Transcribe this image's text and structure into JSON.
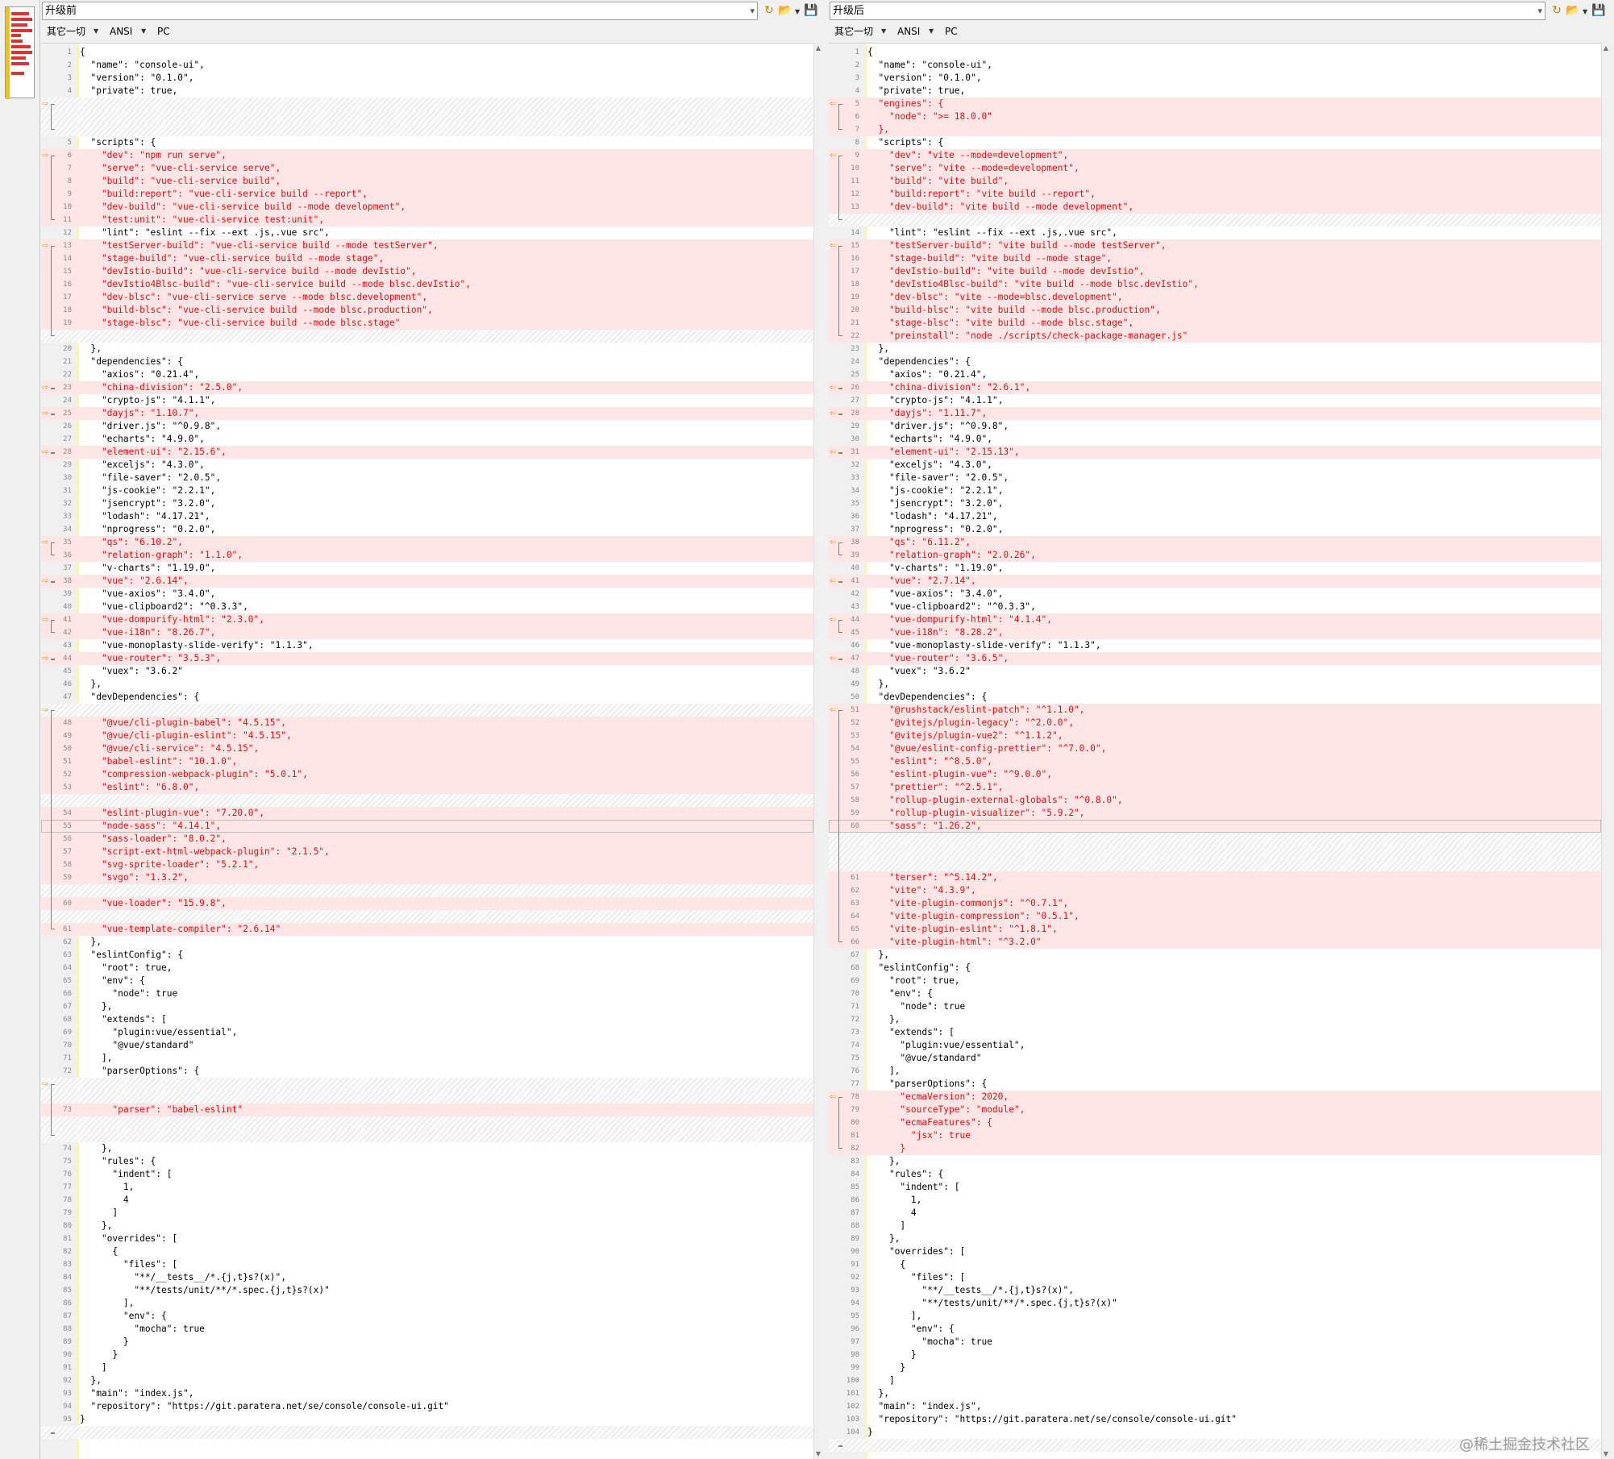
{
  "app": {
    "watermark": "@稀土掘金技术社区"
  },
  "colors": {
    "diff_bg": "#ffe5e5",
    "diff_text": "#dd1111",
    "arrow": "#d99a00"
  },
  "left": {
    "path": "升级前",
    "info": {
      "whitespace": "其它一切",
      "encoding": "ANSI",
      "line_ending": "PC"
    },
    "lines": [
      {
        "n": 1,
        "t": "{"
      },
      {
        "n": 2,
        "t": "  \"name\": \"console-ui\","
      },
      {
        "n": 3,
        "t": "  \"version\": \"0.1.0\","
      },
      {
        "n": 4,
        "t": "  \"private\": true,"
      },
      {
        "gap": true,
        "arrow": true
      },
      {
        "gap": true
      },
      {
        "gap": true
      },
      {
        "n": 5,
        "t": "  \"scripts\": {"
      },
      {
        "n": 6,
        "t": "    \"dev\": \"npm run serve\",",
        "d": true,
        "arrow": true
      },
      {
        "n": 7,
        "t": "    \"serve\": \"vue-cli-service serve\",",
        "d": true
      },
      {
        "n": 8,
        "t": "    \"build\": \"vue-cli-service build\",",
        "d": true
      },
      {
        "n": 9,
        "t": "    \"build:report\": \"vue-cli-service build --report\",",
        "d": true
      },
      {
        "n": 10,
        "t": "    \"dev-build\": \"vue-cli-service build --mode development\",",
        "d": true
      },
      {
        "n": 11,
        "t": "    \"test:unit\": \"vue-cli-service test:unit\",",
        "d": true
      },
      {
        "n": 12,
        "t": "    \"lint\": \"eslint --fix --ext .js,.vue src\","
      },
      {
        "n": 13,
        "t": "    \"testServer-build\": \"vue-cli-service build --mode testServer\",",
        "d": true,
        "arrow": true
      },
      {
        "n": 14,
        "t": "    \"stage-build\": \"vue-cli-service build --mode stage\",",
        "d": true
      },
      {
        "n": 15,
        "t": "    \"devIstio-build\": \"vue-cli-service build --mode devIstio\",",
        "d": true
      },
      {
        "n": 16,
        "t": "    \"devIstio4Blsc-build\": \"vue-cli-service build --mode blsc.devIstio\",",
        "d": true
      },
      {
        "n": 17,
        "t": "    \"dev-blsc\": \"vue-cli-service serve --mode blsc.development\",",
        "d": true
      },
      {
        "n": 18,
        "t": "    \"build-blsc\": \"vue-cli-service build --mode blsc.production\",",
        "d": true
      },
      {
        "n": 19,
        "t": "    \"stage-blsc\": \"vue-cli-service build --mode blsc.stage\"",
        "d": true
      },
      {
        "gap": true
      },
      {
        "n": 20,
        "t": "  },"
      },
      {
        "n": 21,
        "t": "  \"dependencies\": {"
      },
      {
        "n": 22,
        "t": "    \"axios\": \"0.21.4\","
      },
      {
        "n": 23,
        "t": "    \"china-division\": \"2.5.0\",",
        "d": true,
        "arrow": true
      },
      {
        "n": 24,
        "t": "    \"crypto-js\": \"4.1.1\","
      },
      {
        "n": 25,
        "t": "    \"dayjs\": \"1.10.7\",",
        "d": true,
        "arrow": true
      },
      {
        "n": 26,
        "t": "    \"driver.js\": \"^0.9.8\","
      },
      {
        "n": 27,
        "t": "    \"echarts\": \"4.9.0\","
      },
      {
        "n": 28,
        "t": "    \"element-ui\": \"2.15.6\",",
        "d": true,
        "arrow": true
      },
      {
        "n": 29,
        "t": "    \"exceljs\": \"4.3.0\","
      },
      {
        "n": 30,
        "t": "    \"file-saver\": \"2.0.5\","
      },
      {
        "n": 31,
        "t": "    \"js-cookie\": \"2.2.1\","
      },
      {
        "n": 32,
        "t": "    \"jsencrypt\": \"3.2.0\","
      },
      {
        "n": 33,
        "t": "    \"lodash\": \"4.17.21\","
      },
      {
        "n": 34,
        "t": "    \"nprogress\": \"0.2.0\","
      },
      {
        "n": 35,
        "t": "    \"qs\": \"6.10.2\",",
        "d": true,
        "arrow": true
      },
      {
        "n": 36,
        "t": "    \"relation-graph\": \"1.1.0\",",
        "d": true
      },
      {
        "n": 37,
        "t": "    \"v-charts\": \"1.19.0\","
      },
      {
        "n": 38,
        "t": "    \"vue\": \"2.6.14\",",
        "d": true,
        "arrow": true
      },
      {
        "n": 39,
        "t": "    \"vue-axios\": \"3.4.0\","
      },
      {
        "n": 40,
        "t": "    \"vue-clipboard2\": \"^0.3.3\","
      },
      {
        "n": 41,
        "t": "    \"vue-dompurify-html\": \"2.3.0\",",
        "d": true,
        "arrow": true
      },
      {
        "n": 42,
        "t": "    \"vue-i18n\": \"8.26.7\",",
        "d": true
      },
      {
        "n": 43,
        "t": "    \"vue-monoplasty-slide-verify\": \"1.1.3\","
      },
      {
        "n": 44,
        "t": "    \"vue-router\": \"3.5.3\",",
        "d": true,
        "arrow": true
      },
      {
        "n": 45,
        "t": "    \"vuex\": \"3.6.2\""
      },
      {
        "n": 46,
        "t": "  },"
      },
      {
        "n": 47,
        "t": "  \"devDependencies\": {"
      },
      {
        "gap": true,
        "arrow": true
      },
      {
        "n": 48,
        "t": "    \"@vue/cli-plugin-babel\": \"4.5.15\",",
        "d": true
      },
      {
        "n": 49,
        "t": "    \"@vue/cli-plugin-eslint\": \"4.5.15\",",
        "d": true
      },
      {
        "n": 50,
        "t": "    \"@vue/cli-service\": \"4.5.15\",",
        "d": true
      },
      {
        "n": 51,
        "t": "    \"babel-eslint\": \"10.1.0\",",
        "d": true
      },
      {
        "n": 52,
        "t": "    \"compression-webpack-plugin\": \"5.0.1\",",
        "d": true
      },
      {
        "n": 53,
        "t": "    \"eslint\": \"6.8.0\",",
        "d": true
      },
      {
        "gap": true
      },
      {
        "n": 54,
        "t": "    \"eslint-plugin-vue\": \"7.20.0\",",
        "d": true
      },
      {
        "n": 55,
        "t": "    \"node-sass\": \"4.14.1\",",
        "d": true,
        "cursor": true
      },
      {
        "n": 56,
        "t": "    \"sass-loader\": \"8.0.2\",",
        "d": true
      },
      {
        "n": 57,
        "t": "    \"script-ext-html-webpack-plugin\": \"2.1.5\",",
        "d": true
      },
      {
        "n": 58,
        "t": "    \"svg-sprite-loader\": \"5.2.1\",",
        "d": true
      },
      {
        "n": 59,
        "t": "    \"svgo\": \"1.3.2\",",
        "d": true
      },
      {
        "gap": true
      },
      {
        "n": 60,
        "t": "    \"vue-loader\": \"15.9.8\",",
        "d": true
      },
      {
        "gap": true
      },
      {
        "n": 61,
        "t": "    \"vue-template-compiler\": \"2.6.14\"",
        "d": true
      },
      {
        "n": 62,
        "t": "  },"
      },
      {
        "n": 63,
        "t": "  \"eslintConfig\": {"
      },
      {
        "n": 64,
        "t": "    \"root\": true,"
      },
      {
        "n": 65,
        "t": "    \"env\": {"
      },
      {
        "n": 66,
        "t": "      \"node\": true"
      },
      {
        "n": 67,
        "t": "    },"
      },
      {
        "n": 68,
        "t": "    \"extends\": ["
      },
      {
        "n": 69,
        "t": "      \"plugin:vue/essential\","
      },
      {
        "n": 70,
        "t": "      \"@vue/standard\""
      },
      {
        "n": 71,
        "t": "    ],"
      },
      {
        "n": 72,
        "t": "    \"parserOptions\": {"
      },
      {
        "gap": true,
        "arrow": true
      },
      {
        "gap": true
      },
      {
        "n": 73,
        "t": "      \"parser\": \"babel-eslint\"",
        "d": true
      },
      {
        "gap": true
      },
      {
        "gap": true
      },
      {
        "n": 74,
        "t": "    },"
      },
      {
        "n": 75,
        "t": "    \"rules\": {"
      },
      {
        "n": 76,
        "t": "      \"indent\": ["
      },
      {
        "n": 77,
        "t": "        1,"
      },
      {
        "n": 78,
        "t": "        4"
      },
      {
        "n": 79,
        "t": "      ]"
      },
      {
        "n": 80,
        "t": "    },"
      },
      {
        "n": 81,
        "t": "    \"overrides\": ["
      },
      {
        "n": 82,
        "t": "      {"
      },
      {
        "n": 83,
        "t": "        \"files\": ["
      },
      {
        "n": 84,
        "t": "          \"**/__tests__/*.{j,t}s?(x)\","
      },
      {
        "n": 85,
        "t": "          \"**/tests/unit/**/*.spec.{j,t}s?(x)\""
      },
      {
        "n": 86,
        "t": "        ],"
      },
      {
        "n": 87,
        "t": "        \"env\": {"
      },
      {
        "n": 88,
        "t": "          \"mocha\": true"
      },
      {
        "n": 89,
        "t": "        }"
      },
      {
        "n": 90,
        "t": "      }"
      },
      {
        "n": 91,
        "t": "    ]"
      },
      {
        "n": 92,
        "t": "  },"
      },
      {
        "n": 93,
        "t": "  \"main\": \"index.js\","
      },
      {
        "n": 94,
        "t": "  \"repository\": \"https://git.paratera.net/se/console/console-ui.git\""
      },
      {
        "n": 95,
        "t": "}"
      },
      {
        "gap": true
      }
    ]
  },
  "right": {
    "path": "升级后",
    "info": {
      "whitespace": "其它一切",
      "encoding": "ANSI",
      "line_ending": "PC"
    },
    "lines": [
      {
        "n": 1,
        "t": "{"
      },
      {
        "n": 2,
        "t": "  \"name\": \"console-ui\","
      },
      {
        "n": 3,
        "t": "  \"version\": \"0.1.0\","
      },
      {
        "n": 4,
        "t": "  \"private\": true,"
      },
      {
        "n": 5,
        "t": "  \"engines\": {",
        "d": true,
        "arrow": true
      },
      {
        "n": 6,
        "t": "    \"node\": \">= 18.0.0\"",
        "d": true
      },
      {
        "n": 7,
        "t": "  },",
        "d": true
      },
      {
        "n": 8,
        "t": "  \"scripts\": {"
      },
      {
        "n": 9,
        "t": "    \"dev\": \"vite --mode=development\",",
        "d": true,
        "arrow": true
      },
      {
        "n": 10,
        "t": "    \"serve\": \"vite --mode=development\",",
        "d": true
      },
      {
        "n": 11,
        "t": "    \"build\": \"vite build\",",
        "d": true
      },
      {
        "n": 12,
        "t": "    \"build:report\": \"vite build --report\",",
        "d": true
      },
      {
        "n": 13,
        "t": "    \"dev-build\": \"vite build --mode development\",",
        "d": true
      },
      {
        "gap": true
      },
      {
        "n": 14,
        "t": "    \"lint\": \"eslint --fix --ext .js,.vue src\","
      },
      {
        "n": 15,
        "t": "    \"testServer-build\": \"vite build --mode testServer\",",
        "d": true,
        "arrow": true
      },
      {
        "n": 16,
        "t": "    \"stage-build\": \"vite build --mode stage\",",
        "d": true
      },
      {
        "n": 17,
        "t": "    \"devIstio-build\": \"vite build --mode devIstio\",",
        "d": true
      },
      {
        "n": 18,
        "t": "    \"devIstio4Blsc-build\": \"vite build --mode blsc.devIstio\",",
        "d": true
      },
      {
        "n": 19,
        "t": "    \"dev-blsc\": \"vite --mode=blsc.development\",",
        "d": true
      },
      {
        "n": 20,
        "t": "    \"build-blsc\": \"vite build --mode blsc.production\",",
        "d": true
      },
      {
        "n": 21,
        "t": "    \"stage-blsc\": \"vite build --mode blsc.stage\",",
        "d": true
      },
      {
        "n": 22,
        "t": "    \"preinstall\": \"node ./scripts/check-package-manager.js\"",
        "d": true
      },
      {
        "n": 23,
        "t": "  },"
      },
      {
        "n": 24,
        "t": "  \"dependencies\": {"
      },
      {
        "n": 25,
        "t": "    \"axios\": \"0.21.4\","
      },
      {
        "n": 26,
        "t": "    \"china-division\": \"2.6.1\",",
        "d": true,
        "arrow": true
      },
      {
        "n": 27,
        "t": "    \"crypto-js\": \"4.1.1\","
      },
      {
        "n": 28,
        "t": "    \"dayjs\": \"1.11.7\",",
        "d": true,
        "arrow": true
      },
      {
        "n": 29,
        "t": "    \"driver.js\": \"^0.9.8\","
      },
      {
        "n": 30,
        "t": "    \"echarts\": \"4.9.0\","
      },
      {
        "n": 31,
        "t": "    \"element-ui\": \"2.15.13\",",
        "d": true,
        "arrow": true
      },
      {
        "n": 32,
        "t": "    \"exceljs\": \"4.3.0\","
      },
      {
        "n": 33,
        "t": "    \"file-saver\": \"2.0.5\","
      },
      {
        "n": 34,
        "t": "    \"js-cookie\": \"2.2.1\","
      },
      {
        "n": 35,
        "t": "    \"jsencrypt\": \"3.2.0\","
      },
      {
        "n": 36,
        "t": "    \"lodash\": \"4.17.21\","
      },
      {
        "n": 37,
        "t": "    \"nprogress\": \"0.2.0\","
      },
      {
        "n": 38,
        "t": "    \"qs\": \"6.11.2\",",
        "d": true,
        "arrow": true
      },
      {
        "n": 39,
        "t": "    \"relation-graph\": \"2.0.26\",",
        "d": true
      },
      {
        "n": 40,
        "t": "    \"v-charts\": \"1.19.0\","
      },
      {
        "n": 41,
        "t": "    \"vue\": \"2.7.14\",",
        "d": true,
        "arrow": true
      },
      {
        "n": 42,
        "t": "    \"vue-axios\": \"3.4.0\","
      },
      {
        "n": 43,
        "t": "    \"vue-clipboard2\": \"^0.3.3\","
      },
      {
        "n": 44,
        "t": "    \"vue-dompurify-html\": \"4.1.4\",",
        "d": true,
        "arrow": true
      },
      {
        "n": 45,
        "t": "    \"vue-i18n\": \"8.28.2\",",
        "d": true
      },
      {
        "n": 46,
        "t": "    \"vue-monoplasty-slide-verify\": \"1.1.3\","
      },
      {
        "n": 47,
        "t": "    \"vue-router\": \"3.6.5\",",
        "d": true,
        "arrow": true
      },
      {
        "n": 48,
        "t": "    \"vuex\": \"3.6.2\""
      },
      {
        "n": 49,
        "t": "  },"
      },
      {
        "n": 50,
        "t": "  \"devDependencies\": {"
      },
      {
        "n": 51,
        "t": "    \"@rushstack/eslint-patch\": \"^1.1.0\",",
        "d": true,
        "arrow": true
      },
      {
        "n": 52,
        "t": "    \"@vitejs/plugin-legacy\": \"^2.0.0\",",
        "d": true
      },
      {
        "n": 53,
        "t": "    \"@vitejs/plugin-vue2\": \"^1.1.2\",",
        "d": true
      },
      {
        "n": 54,
        "t": "    \"@vue/eslint-config-prettier\": \"^7.0.0\",",
        "d": true
      },
      {
        "n": 55,
        "t": "    \"eslint\": \"^8.5.0\",",
        "d": true
      },
      {
        "n": 56,
        "t": "    \"eslint-plugin-vue\": \"^9.0.0\",",
        "d": true
      },
      {
        "n": 57,
        "t": "    \"prettier\": \"^2.5.1\",",
        "d": true
      },
      {
        "n": 58,
        "t": "    \"rollup-plugin-external-globals\": \"^0.8.0\",",
        "d": true
      },
      {
        "n": 59,
        "t": "    \"rollup-plugin-visualizer\": \"5.9.2\",",
        "d": true
      },
      {
        "n": 60,
        "t": "    \"sass\": \"1.26.2\",",
        "d": true,
        "cursor": true
      },
      {
        "gap": true
      },
      {
        "gap": true
      },
      {
        "gap": true
      },
      {
        "n": 61,
        "t": "    \"terser\": \"^5.14.2\",",
        "d": true
      },
      {
        "n": 62,
        "t": "    \"vite\": \"4.3.9\",",
        "d": true
      },
      {
        "n": 63,
        "t": "    \"vite-plugin-commonjs\": \"^0.7.1\",",
        "d": true
      },
      {
        "n": 64,
        "t": "    \"vite-plugin-compression\": \"0.5.1\",",
        "d": true
      },
      {
        "n": 65,
        "t": "    \"vite-plugin-eslint\": \"^1.8.1\",",
        "d": true
      },
      {
        "n": 66,
        "t": "    \"vite-plugin-html\": \"^3.2.0\"",
        "d": true
      },
      {
        "n": 67,
        "t": "  },"
      },
      {
        "n": 68,
        "t": "  \"eslintConfig\": {"
      },
      {
        "n": 69,
        "t": "    \"root\": true,"
      },
      {
        "n": 70,
        "t": "    \"env\": {"
      },
      {
        "n": 71,
        "t": "      \"node\": true"
      },
      {
        "n": 72,
        "t": "    },"
      },
      {
        "n": 73,
        "t": "    \"extends\": ["
      },
      {
        "n": 74,
        "t": "      \"plugin:vue/essential\","
      },
      {
        "n": 75,
        "t": "      \"@vue/standard\""
      },
      {
        "n": 76,
        "t": "    ],"
      },
      {
        "n": 77,
        "t": "    \"parserOptions\": {"
      },
      {
        "n": 78,
        "t": "      \"ecmaVersion\": 2020,",
        "d": true,
        "arrow": true
      },
      {
        "n": 79,
        "t": "      \"sourceType\": \"module\",",
        "d": true
      },
      {
        "n": 80,
        "t": "      \"ecmaFeatures\": {",
        "d": true
      },
      {
        "n": 81,
        "t": "        \"jsx\": true",
        "d": true
      },
      {
        "n": 82,
        "t": "      }",
        "d": true
      },
      {
        "n": 83,
        "t": "    },"
      },
      {
        "n": 84,
        "t": "    \"rules\": {"
      },
      {
        "n": 85,
        "t": "      \"indent\": ["
      },
      {
        "n": 86,
        "t": "        1,"
      },
      {
        "n": 87,
        "t": "        4"
      },
      {
        "n": 88,
        "t": "      ]"
      },
      {
        "n": 89,
        "t": "    },"
      },
      {
        "n": 90,
        "t": "    \"overrides\": ["
      },
      {
        "n": 91,
        "t": "      {"
      },
      {
        "n": 92,
        "t": "        \"files\": ["
      },
      {
        "n": 93,
        "t": "          \"**/__tests__/*.{j,t}s?(x)\","
      },
      {
        "n": 94,
        "t": "          \"**/tests/unit/**/*.spec.{j,t}s?(x)\""
      },
      {
        "n": 95,
        "t": "        ],"
      },
      {
        "n": 96,
        "t": "        \"env\": {"
      },
      {
        "n": 97,
        "t": "          \"mocha\": true"
      },
      {
        "n": 98,
        "t": "        }"
      },
      {
        "n": 99,
        "t": "      }"
      },
      {
        "n": 100,
        "t": "    ]"
      },
      {
        "n": 101,
        "t": "  },"
      },
      {
        "n": 102,
        "t": "  \"main\": \"index.js\","
      },
      {
        "n": 103,
        "t": "  \"repository\": \"https://git.paratera.net/se/console/console-ui.git\""
      },
      {
        "n": 104,
        "t": "}"
      },
      {
        "gap": true
      }
    ]
  }
}
